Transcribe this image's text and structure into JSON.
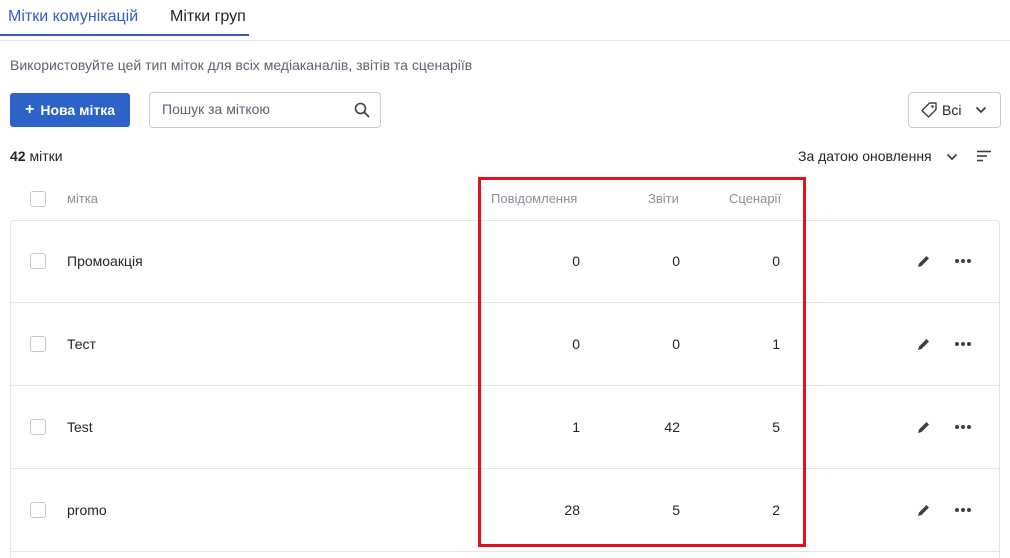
{
  "tabs": [
    {
      "label": "Мітки комунікацій",
      "active": true
    },
    {
      "label": "Мітки груп",
      "active": false
    }
  ],
  "description": "Використовуйте цей тип міток для всіх медіаканалів, звітів та сценаріїв",
  "toolbar": {
    "new_button_icon": "+",
    "new_button_label": "Нова мітка",
    "search_placeholder": "Пошук за міткою",
    "filter_label": "Всі"
  },
  "summary": {
    "count": "42",
    "count_suffix": "мітки",
    "sort_label": "За датою оновлення"
  },
  "table": {
    "headers": {
      "name": "мітка",
      "messages": "Повідомлення",
      "reports": "Звіти",
      "scenarios": "Сценарії"
    },
    "rows": [
      {
        "name": "Промоакція",
        "messages": "0",
        "reports": "0",
        "scenarios": "0"
      },
      {
        "name": "Тест",
        "messages": "0",
        "reports": "0",
        "scenarios": "1"
      },
      {
        "name": "Test",
        "messages": "1",
        "reports": "42",
        "scenarios": "5"
      },
      {
        "name": "promo",
        "messages": "28",
        "reports": "5",
        "scenarios": "2"
      }
    ]
  },
  "colors": {
    "accent": "#2d63c8",
    "highlight": "#e0121b"
  }
}
